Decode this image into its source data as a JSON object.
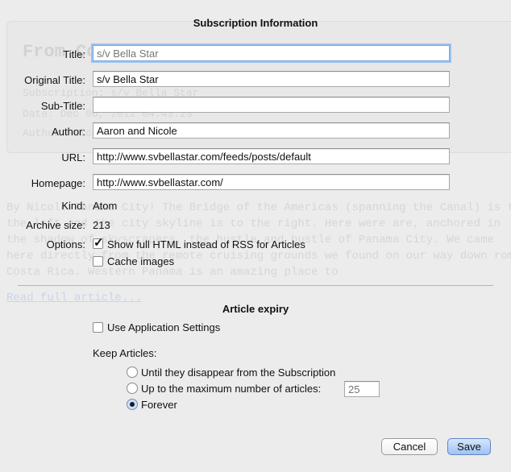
{
  "background": {
    "title": "From Co",
    "meta": [
      "Subscription: s/v Bella Star",
      "Date: Dec 06, 2012 04:43:23",
      "Author: Nicole"
    ],
    "body": "By Nicole Panama City! The Bridge of the Americas (spanning the Canal) is to the left and the city skyline is to the right. Here were are, anchored in the shadow of skyscrapers, the hustle and bustle of Panama City. We came here directly from the remote cruising grounds we found on our way down rom Costa Rica. Western Panama is an amazing place to",
    "link": "Read full article..."
  },
  "dialog": {
    "heading": "Subscription Information",
    "fields": {
      "title_label": "Title:",
      "title_value": "s/v Bella Star",
      "original_title_label": "Original Title:",
      "original_title_value": "s/v Bella Star",
      "subtitle_label": "Sub-Title:",
      "subtitle_value": "",
      "author_label": "Author:",
      "author_value": "Aaron and Nicole",
      "url_label": "URL:",
      "url_value": "http://www.svbellastar.com/feeds/posts/default",
      "homepage_label": "Homepage:",
      "homepage_value": "http://www.svbellastar.com/"
    },
    "info": {
      "kind_label": "Kind:",
      "kind_value": "Atom",
      "archive_label": "Archive size:",
      "archive_value": "213",
      "options_label": "Options:",
      "option_full_html": "Show full HTML instead of RSS for Articles",
      "option_full_html_checked": true,
      "option_cache_images": "Cache images",
      "option_cache_images_checked": false
    },
    "expiry": {
      "heading": "Article expiry",
      "use_app_settings": "Use Application Settings",
      "use_app_settings_checked": false,
      "keep_label": "Keep Articles:",
      "options": [
        "Until they disappear from the Subscription",
        "Up to the maximum number of articles:",
        "Forever"
      ],
      "selected": 2,
      "max_articles_placeholder": "25"
    },
    "buttons": {
      "cancel": "Cancel",
      "save": "Save"
    }
  }
}
